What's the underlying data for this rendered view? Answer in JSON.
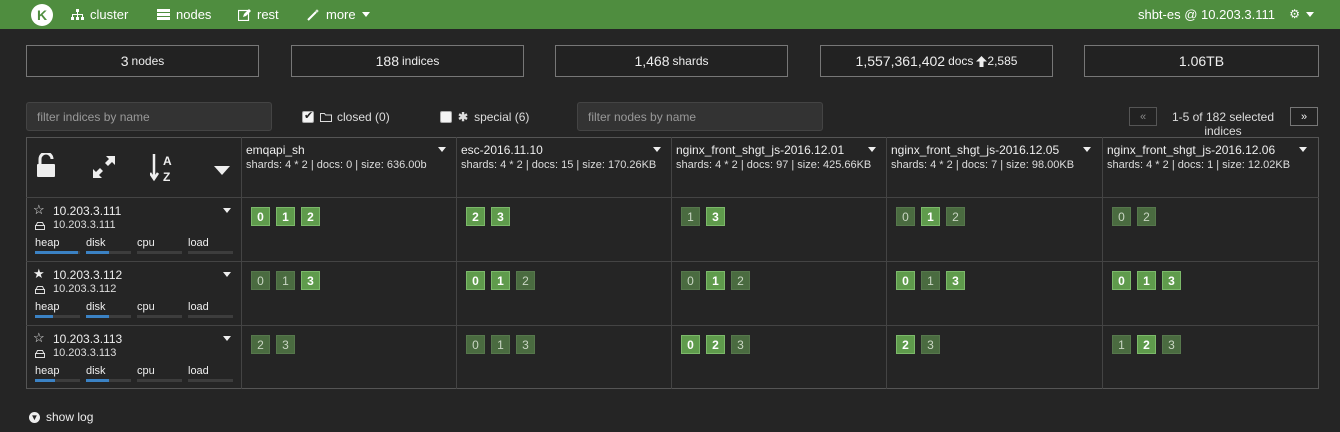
{
  "nav": {
    "logo": "K",
    "items": [
      {
        "label": "cluster",
        "icon": "sitemap-icon"
      },
      {
        "label": "nodes",
        "icon": "server-icon"
      },
      {
        "label": "rest",
        "icon": "edit-icon"
      },
      {
        "label": "more",
        "icon": "magic-wand-icon"
      }
    ],
    "cluster_label": "shbt-es @ 10.203.3.111",
    "accent": "#4f8d3f"
  },
  "stats": {
    "nodes_value": "3",
    "nodes_label": "nodes",
    "indices_value": "188",
    "indices_label": "indices",
    "shards_value": "1,468",
    "shards_label": "shards",
    "docs_value": "1,557,361,402",
    "docs_label": "docs",
    "docs_delta": "2,585",
    "size": "1.06TB"
  },
  "filters": {
    "indices_placeholder": "filter indices by name",
    "closed_label": "closed (0)",
    "closed_checked": true,
    "special_label": "special (6)",
    "special_checked": false,
    "nodes_placeholder": "filter nodes by name"
  },
  "pagination": {
    "prev": "«",
    "next": "»",
    "info_line1": "1-5 of 182 selected",
    "info_line2": "indices"
  },
  "indices": [
    {
      "name": "emqapi_sh",
      "info": "shards: 4 * 2 | docs: 0 | size: 636.00b"
    },
    {
      "name": "esc-2016.11.10",
      "info": "shards: 4 * 2 | docs: 15 | size: 170.26KB"
    },
    {
      "name": "nginx_front_shgt_js-2016.12.01",
      "info": "shards: 4 * 2 | docs: 97 | size: 425.66KB"
    },
    {
      "name": "nginx_front_shgt_js-2016.12.05",
      "info": "shards: 4 * 2 | docs: 7 | size: 98.00KB"
    },
    {
      "name": "nginx_front_shgt_js-2016.12.06",
      "info": "shards: 4 * 2 | docs: 1 | size: 12.02KB"
    }
  ],
  "nodes": [
    {
      "name": "10.203.3.111",
      "host": "10.203.3.111",
      "master": false,
      "heap": 0.95,
      "disk": 0.5,
      "cpu": 0.0,
      "load": 0.0
    },
    {
      "name": "10.203.3.112",
      "host": "10.203.3.112",
      "master": true,
      "heap": 0.4,
      "disk": 0.5,
      "cpu": 0.0,
      "load": 0.0
    },
    {
      "name": "10.203.3.113",
      "host": "10.203.3.113",
      "master": false,
      "heap": 0.45,
      "disk": 0.5,
      "cpu": 0.0,
      "load": 0.0
    }
  ],
  "metric_labels": {
    "heap": "heap",
    "disk": "disk",
    "cpu": "cpu",
    "load": "load"
  },
  "shards": [
    [
      [
        [
          "0",
          "p"
        ],
        [
          "1",
          "p"
        ],
        [
          "2",
          "p"
        ]
      ],
      [
        [
          "2",
          "p"
        ],
        [
          "3",
          "p"
        ]
      ],
      [
        [
          "1",
          "r"
        ],
        [
          "3",
          "p"
        ]
      ],
      [
        [
          "0",
          "r"
        ],
        [
          "1",
          "p"
        ],
        [
          "2",
          "r"
        ]
      ],
      [
        [
          "0",
          "r"
        ],
        [
          "2",
          "r"
        ]
      ]
    ],
    [
      [
        [
          "0",
          "r"
        ],
        [
          "1",
          "r"
        ],
        [
          "3",
          "p"
        ]
      ],
      [
        [
          "0",
          "p"
        ],
        [
          "1",
          "p"
        ],
        [
          "2",
          "r"
        ]
      ],
      [
        [
          "0",
          "r"
        ],
        [
          "1",
          "p"
        ],
        [
          "2",
          "r"
        ]
      ],
      [
        [
          "0",
          "p"
        ],
        [
          "1",
          "r"
        ],
        [
          "3",
          "p"
        ]
      ],
      [
        [
          "0",
          "p"
        ],
        [
          "1",
          "p"
        ],
        [
          "3",
          "p"
        ]
      ]
    ],
    [
      [
        [
          "2",
          "r"
        ],
        [
          "3",
          "r"
        ]
      ],
      [
        [
          "0",
          "r"
        ],
        [
          "1",
          "r"
        ],
        [
          "3",
          "r"
        ]
      ],
      [
        [
          "0",
          "p"
        ],
        [
          "2",
          "p"
        ],
        [
          "3",
          "r"
        ]
      ],
      [
        [
          "2",
          "p"
        ],
        [
          "3",
          "r"
        ]
      ],
      [
        [
          "1",
          "r"
        ],
        [
          "2",
          "p"
        ],
        [
          "3",
          "r"
        ]
      ]
    ]
  ],
  "footer": {
    "show_log": "show log"
  }
}
